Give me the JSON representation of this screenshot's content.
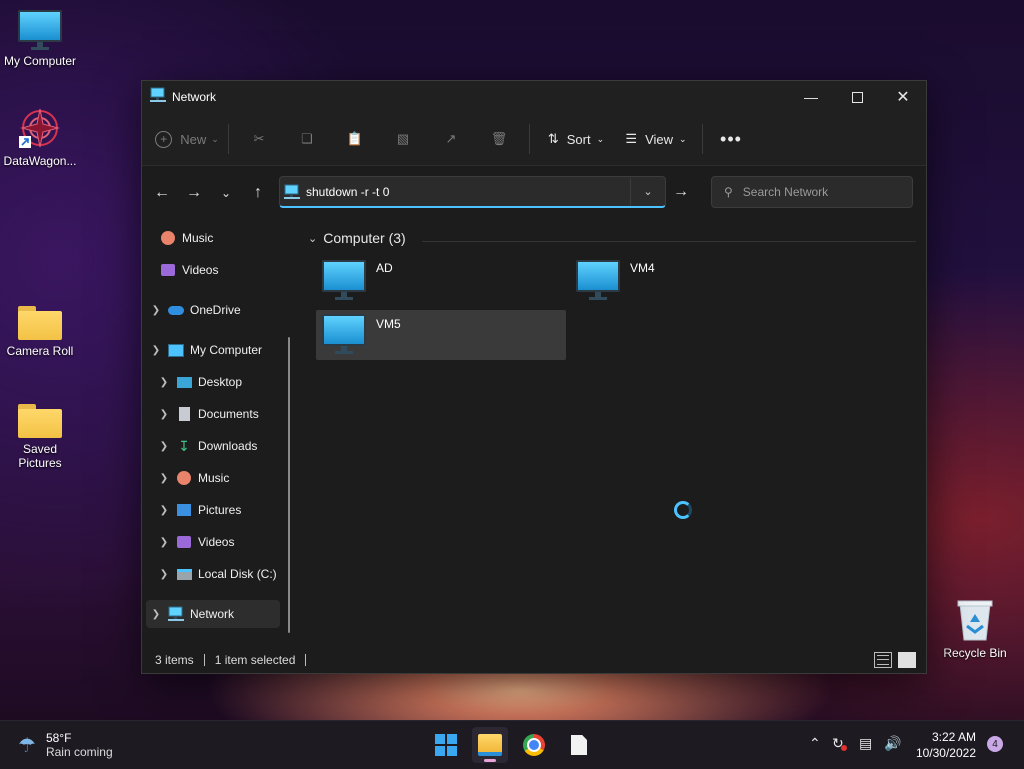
{
  "desktop": {
    "icons": [
      {
        "label": "My Computer",
        "icon": "monitor-icon"
      },
      {
        "label": "DataWagon...",
        "icon": "app-shortcut-icon"
      },
      {
        "label": "Camera Roll",
        "icon": "folder-icon"
      },
      {
        "label": "Saved Pictures",
        "icon": "folder-icon"
      },
      {
        "label": "Recycle Bin",
        "icon": "recycle-bin-icon"
      }
    ]
  },
  "window": {
    "title": "Network",
    "toolbar": {
      "new_label": "New",
      "sort_label": "Sort",
      "view_label": "View"
    },
    "address": {
      "value": "shutdown -r -t 0"
    },
    "search": {
      "placeholder": "Search Network"
    },
    "sidebar": {
      "items": [
        {
          "label": "Music"
        },
        {
          "label": "Videos"
        },
        {
          "label": "OneDrive"
        },
        {
          "label": "My Computer"
        },
        {
          "label": "Desktop"
        },
        {
          "label": "Documents"
        },
        {
          "label": "Downloads"
        },
        {
          "label": "Music"
        },
        {
          "label": "Pictures"
        },
        {
          "label": "Videos"
        },
        {
          "label": "Local Disk (C:)"
        },
        {
          "label": "Network"
        }
      ]
    },
    "content": {
      "group_label": "Computer (3)",
      "items": [
        {
          "label": "AD"
        },
        {
          "label": "VM4"
        },
        {
          "label": "VM5"
        }
      ]
    },
    "status": {
      "items_count": "3 items",
      "selected": "1 item selected"
    }
  },
  "taskbar": {
    "weather": {
      "temp": "58°F",
      "desc": "Rain coming"
    },
    "clock": {
      "time": "3:22 AM",
      "date": "10/30/2022"
    },
    "notification_count": "4"
  },
  "colors": {
    "accent": "#4cc2ff",
    "window_bg": "#1c1c1c",
    "selection": "#3a3a3a"
  }
}
